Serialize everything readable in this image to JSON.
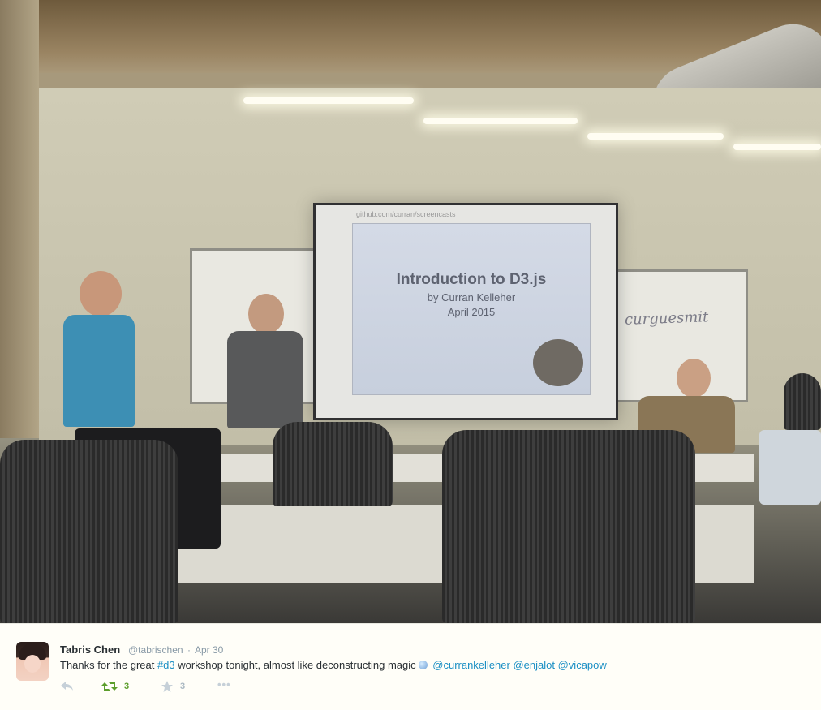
{
  "photo": {
    "slide": {
      "url": "github.com/curran/screencasts",
      "title": "Introduction to D3.js",
      "author": "by Curran Kelleher",
      "date": "April 2015"
    },
    "whiteboard_text": "curguesmit"
  },
  "tweet": {
    "display_name": "Tabris Chen",
    "handle": "@tabrischen",
    "separator": "·",
    "date": "Apr 30",
    "text_before": "Thanks for the great ",
    "hashtag": "#d3",
    "text_after": " workshop tonight, almost like deconstructing magic",
    "mentions": [
      "@currankelleher",
      "@enjalot",
      "@vicapow"
    ],
    "actions": {
      "reply_icon": "reply-icon",
      "retweet_icon": "retweet-icon",
      "retweet_count": "3",
      "favorite_icon": "star-icon",
      "favorite_count": "3",
      "more_icon": "more-icon"
    },
    "colors": {
      "link": "#1b8fc4",
      "retweet": "#5c9e2c",
      "muted": "#aab8c2"
    }
  }
}
